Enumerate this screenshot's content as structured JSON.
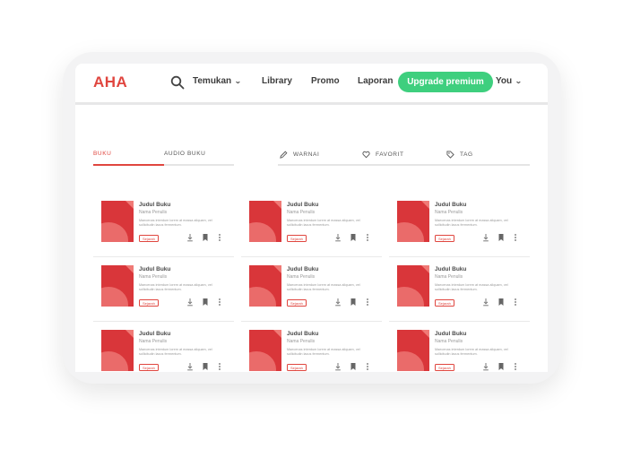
{
  "brand": {
    "logo": "AHA",
    "accent": "#e0463f",
    "cta_color": "#3ecf7e"
  },
  "nav": {
    "search_icon": "search-icon",
    "discover": "Temukan",
    "library": "Library",
    "promo": "Promo",
    "report": "Laporan",
    "upgrade": "Upgrade premium",
    "user": "You"
  },
  "tabs": {
    "books": "BUKU",
    "audiobooks": "AUDIO BUKU",
    "active": "BUKU"
  },
  "tools": {
    "color": "WARNAI",
    "favorite": "FAVORIT",
    "tag": "TAG"
  },
  "books": [
    {
      "title": "Judul Buku",
      "author": "Nama Penulis",
      "description": "Maecenas interdum lorem at massa aliquam, vel sollicitudin lacus fermentum.",
      "badge": "Sejarah"
    },
    {
      "title": "Judul Buku",
      "author": "Nama Penulis",
      "description": "Maecenas interdum lorem at massa aliquam, vel sollicitudin lacus fermentum.",
      "badge": "Sejarah"
    },
    {
      "title": "Judul Buku",
      "author": "Nama Penulis",
      "description": "Maecenas interdum lorem at massa aliquam, vel sollicitudin lacus fermentum.",
      "badge": "Sejarah"
    },
    {
      "title": "Judul Buku",
      "author": "Nama Penulis",
      "description": "Maecenas interdum lorem at massa aliquam, vel sollicitudin lacus fermentum.",
      "badge": "Sejarah"
    },
    {
      "title": "Judul Buku",
      "author": "Nama Penulis",
      "description": "Maecenas interdum lorem at massa aliquam, vel sollicitudin lacus fermentum.",
      "badge": "Sejarah"
    },
    {
      "title": "Judul Buku",
      "author": "Nama Penulis",
      "description": "Maecenas interdum lorem at massa aliquam, vel sollicitudin lacus fermentum.",
      "badge": "Sejarah"
    },
    {
      "title": "Judul Buku",
      "author": "Nama Penulis",
      "description": "Maecenas interdum lorem at massa aliquam, vel sollicitudin lacus fermentum.",
      "badge": "Sejarah"
    },
    {
      "title": "Judul Buku",
      "author": "Nama Penulis",
      "description": "Maecenas interdum lorem at massa aliquam, vel sollicitudin lacus fermentum.",
      "badge": "Sejarah"
    },
    {
      "title": "Judul Buku",
      "author": "Nama Penulis",
      "description": "Maecenas interdum lorem at massa aliquam, vel sollicitudin lacus fermentum.",
      "badge": "Sejarah"
    }
  ]
}
